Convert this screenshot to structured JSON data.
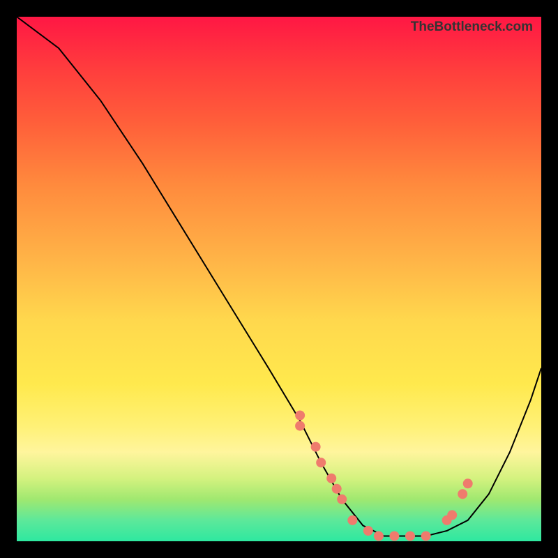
{
  "watermark": "TheBottleneck.com",
  "chart_data": {
    "type": "line",
    "title": "",
    "xlabel": "",
    "ylabel": "",
    "xlim": [
      0,
      100
    ],
    "ylim": [
      0,
      100
    ],
    "series": [
      {
        "name": "bottleneck-curve",
        "x": [
          0,
          8,
          16,
          24,
          32,
          40,
          48,
          54,
          58,
          62,
          66,
          70,
          74,
          78,
          82,
          86,
          90,
          94,
          98,
          100
        ],
        "values": [
          100,
          94,
          84,
          72,
          59,
          46,
          33,
          23,
          15,
          8,
          3,
          1,
          1,
          1,
          2,
          4,
          9,
          17,
          27,
          33
        ]
      }
    ],
    "markers": {
      "name": "highlighted-points",
      "color": "#ef7b6d",
      "x": [
        54,
        54,
        57,
        58,
        60,
        61,
        62,
        64,
        67,
        69,
        72,
        75,
        78,
        82,
        83,
        85,
        86
      ],
      "values": [
        24,
        22,
        18,
        15,
        12,
        10,
        8,
        4,
        2,
        1,
        1,
        1,
        1,
        4,
        5,
        9,
        11
      ]
    }
  }
}
